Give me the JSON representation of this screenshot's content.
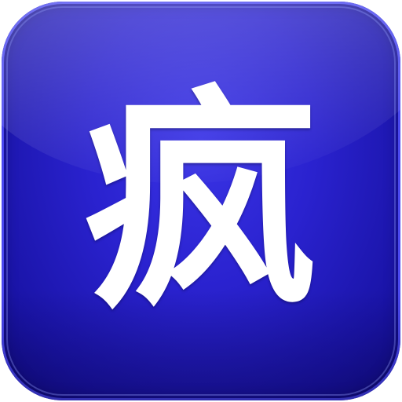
{
  "app_icon": {
    "glyph": "疯",
    "colors": {
      "background": "#2a22cf",
      "background_dark": "#120d86",
      "glyph": "#ffffff"
    }
  }
}
